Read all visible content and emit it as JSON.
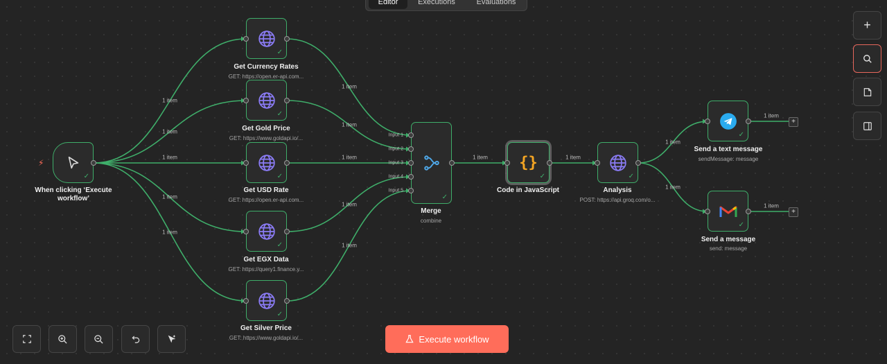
{
  "tabs": [
    {
      "label": "Editor",
      "active": true
    },
    {
      "label": "Executions",
      "active": false
    },
    {
      "label": "Evaluations",
      "active": false
    }
  ],
  "nodes": {
    "trigger": {
      "title_line1": "When clicking ‘Execute",
      "title_line2": "workflow’",
      "icon": "cursor-pointer-icon"
    },
    "currency": {
      "title": "Get Currency Rates",
      "subtitle": "GET: https://open.er-api.com...",
      "icon": "globe-icon"
    },
    "gold": {
      "title": "Get Gold Price",
      "subtitle": "GET: https://www.goldapi.io/...",
      "icon": "globe-icon"
    },
    "usd": {
      "title": "Get USD Rate",
      "subtitle": "GET: https://open.er-api.com...",
      "icon": "globe-icon"
    },
    "egx": {
      "title": "Get EGX Data",
      "subtitle": "GET: https://query1.finance.y...",
      "icon": "globe-icon"
    },
    "silver": {
      "title": "Get Silver Price",
      "subtitle": "GET: https://www.goldapi.io/...",
      "icon": "globe-icon"
    },
    "merge": {
      "title": "Merge",
      "subtitle": "combine",
      "icon": "merge-icon",
      "inputs": [
        "Input 1",
        "Input 2",
        "Input 3",
        "Input 4",
        "Input 5"
      ]
    },
    "code": {
      "title": "Code in JavaScript",
      "icon": "code-braces-icon"
    },
    "analysis": {
      "title": "Analysis",
      "subtitle": "POST: https://api.groq.com/o...",
      "icon": "globe-icon"
    },
    "telegram": {
      "title": "Send a text message",
      "subtitle": "sendMessage: message",
      "icon": "telegram-icon"
    },
    "gmail": {
      "title": "Send a message",
      "subtitle": "send: message",
      "icon": "gmail-icon"
    }
  },
  "edge_item_label": "1 item",
  "execute_button": {
    "label": "Execute workflow",
    "icon": "flask-icon"
  },
  "right_toolbar": [
    "plus-icon",
    "search-icon",
    "sticky-note-icon",
    "panel-toggle-icon"
  ],
  "bottom_toolbar": [
    "fit-view-icon",
    "zoom-in-icon",
    "zoom-out-icon",
    "undo-icon",
    "tidy-up-icon"
  ],
  "colors": {
    "background": "#242424",
    "node_border_success": "#3fae6a",
    "accent": "#ff6d5a",
    "globe": "#8b7cf6",
    "code": "#f5a623",
    "telegram": "#2aabee"
  }
}
